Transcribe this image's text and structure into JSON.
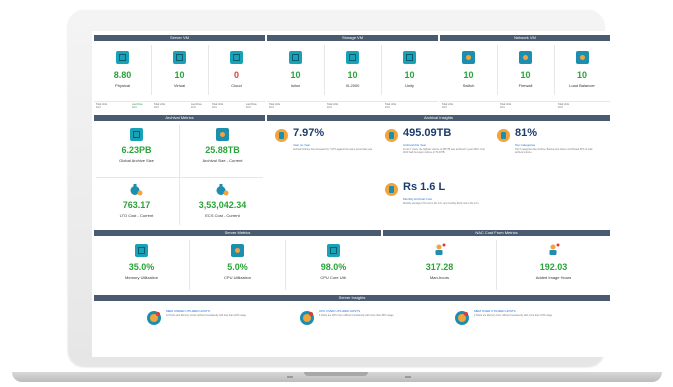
{
  "server_vm": {
    "title": "Server VM",
    "cards": [
      {
        "value": "8.80",
        "label": "Physical",
        "color": "#2aa339"
      },
      {
        "value": "10",
        "label": "Virtual",
        "color": "#2aa339"
      },
      {
        "value": "0",
        "label": "Cloud",
        "color": "#e53935"
      }
    ],
    "strip": [
      {
        "k1": "Total Units",
        "v1": "10.0",
        "k2": "Last Drive",
        "v2": "10.0"
      },
      {
        "k1": "Total Units",
        "v1": "10.0",
        "k2": "Last Drive",
        "v2": "10.0"
      },
      {
        "k1": "Total Units",
        "v1": "10.0",
        "k2": "Last Drive",
        "v2": "10.0"
      }
    ]
  },
  "storage_vm": {
    "title": "Storage VM",
    "cards": [
      {
        "value": "10",
        "label": "Isilon"
      },
      {
        "value": "10",
        "label": "XL2000"
      },
      {
        "value": "10",
        "label": "Unity"
      }
    ]
  },
  "network_vm": {
    "title": "Network VM",
    "cards": [
      {
        "value": "10",
        "label": "Switch"
      },
      {
        "value": "10",
        "label": "Firewall"
      },
      {
        "value": "10",
        "label": "Load Balancer"
      }
    ]
  },
  "archival_metrics": {
    "title": "Archival Metrics",
    "cards": [
      {
        "value": "6.23PB",
        "label": "Global Archive Size"
      },
      {
        "value": "25.88TB",
        "label": "Archival Size - Current"
      },
      {
        "value": "763.17",
        "label": "LTO Cost - Current"
      },
      {
        "value": "3,53,042.34",
        "label": "ECS Cost - Current"
      }
    ]
  },
  "archival_insights": {
    "title": "Archival Insights",
    "items": [
      {
        "value": "7.97%",
        "label": "Year on Year",
        "desc": "Archival Volume has increased by 7.97% against the same period last year"
      },
      {
        "value": "495.09TB",
        "label": "Archival this Year",
        "desc": "In last 7 years, the highest volume of 495 TB was archived in year 2019. Year 2019 had the larger volume of 70.00TB"
      },
      {
        "value": "81%",
        "label": "Top Categories",
        "desc": "Top 5 categories like Archive, Backup and others contributed 81% of total archival volume"
      },
      {
        "value": "Rs 1.6 L",
        "label": "Monthly Archival Cost",
        "desc": "Monthly average LTO cost is Rs 1.6 L and monthly ECS cost is Rs 1.6 L"
      }
    ]
  },
  "server_metrics": {
    "title": "Server Metrics",
    "cards": [
      {
        "value": "35.0%",
        "label": "Memory Utilization"
      },
      {
        "value": "5.0%",
        "label": "CPU Utilization"
      },
      {
        "value": "98.0%",
        "label": "CPU Core Util."
      }
    ]
  },
  "nac_cost": {
    "title": "NAC Cost From Metrics",
    "cards": [
      {
        "value": "317.28",
        "label": "Man-hours"
      },
      {
        "value": "192.03",
        "label": "Added Image Hours"
      }
    ]
  },
  "server_insights": {
    "title": "Server Insights",
    "items": [
      {
        "title": "MEM UNDER UTILIZED HOSTS",
        "desc": "10 Hosts and Memory Under utilized Consistently with less than 20% usage"
      },
      {
        "title": "CPU OVER UTILIZED HOSTS",
        "desc": "4 Hosts are CPU Over utilized Consistently with more than 80% usage"
      },
      {
        "title": "MEM OVER UTILIZED HOSTS",
        "desc": "2 Hosts are Memory Over utilized Consistently with more than 70% usage"
      }
    ]
  }
}
